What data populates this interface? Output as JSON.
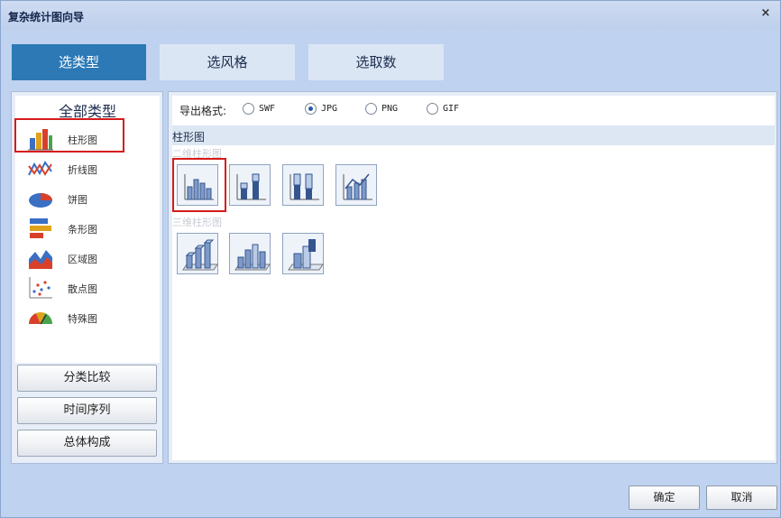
{
  "window": {
    "title": "复杂统计图向导",
    "close_label": "×"
  },
  "steps": [
    "选类型",
    "选风格",
    "选取数"
  ],
  "left": {
    "heading": "全部类型",
    "types": [
      {
        "label": "柱形图",
        "icon": "column-chart-icon"
      },
      {
        "label": "折线图",
        "icon": "line-chart-icon"
      },
      {
        "label": "饼图",
        "icon": "pie-chart-icon"
      },
      {
        "label": "条形图",
        "icon": "bar-chart-icon"
      },
      {
        "label": "区域图",
        "icon": "area-chart-icon"
      },
      {
        "label": "散点图",
        "icon": "scatter-chart-icon"
      },
      {
        "label": "特殊图",
        "icon": "gauge-chart-icon"
      }
    ],
    "categories": [
      "分类比较",
      "时间序列",
      "总体构成"
    ]
  },
  "right": {
    "format_label": "导出格式:",
    "formats": [
      "SWF",
      "JPG",
      "PNG",
      "GIF"
    ],
    "selected_format": "JPG",
    "section_title": "柱形图",
    "group_2d": "二维柱形图",
    "group_3d": "三维柱形图"
  },
  "footer": {
    "ok_label": "确定",
    "cancel_label": "取消"
  },
  "colors": {
    "accent": "#2c79b6",
    "selection": "#d61b1b",
    "background": "#bfd2ef"
  }
}
